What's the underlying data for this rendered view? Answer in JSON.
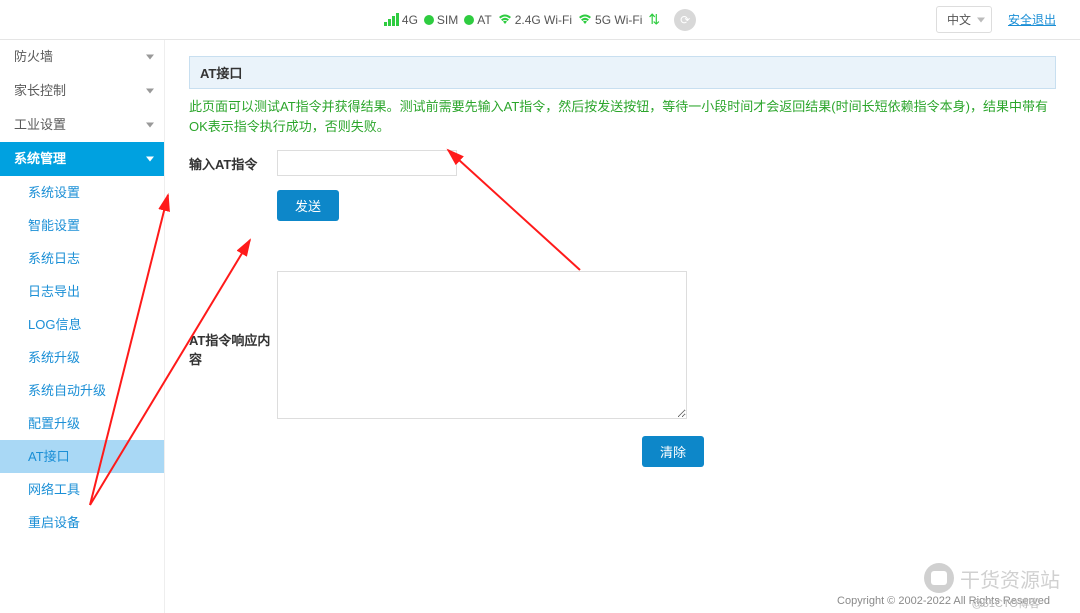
{
  "topbar": {
    "status": {
      "s4g": "4G",
      "sim": "SIM",
      "at": "AT",
      "wifi24": "2.4G Wi-Fi",
      "wifi5": "5G Wi-Fi"
    },
    "lang": "中文",
    "logout": "安全退出"
  },
  "sidebar": {
    "groups": [
      {
        "label": "防火墙"
      },
      {
        "label": "家长控制"
      },
      {
        "label": "工业设置"
      },
      {
        "label": "系统管理",
        "active": true
      }
    ],
    "submenu": [
      {
        "label": "系统设置"
      },
      {
        "label": "智能设置"
      },
      {
        "label": "系统日志"
      },
      {
        "label": "日志导出"
      },
      {
        "label": "LOG信息"
      },
      {
        "label": "系统升级"
      },
      {
        "label": "系统自动升级"
      },
      {
        "label": "配置升级"
      },
      {
        "label": "AT接口",
        "active": true
      },
      {
        "label": "网络工具"
      },
      {
        "label": "重启设备"
      }
    ]
  },
  "content": {
    "panel_title": "AT接口",
    "panel_desc": "此页面可以测试AT指令并获得结果。测试前需要先输入AT指令，然后按发送按钮，等待一小段时间才会返回结果(时间长短依赖指令本身)，结果中带有OK表示指令执行成功，否则失败。",
    "input_label": "输入AT指令",
    "send_btn": "发送",
    "resp_label": "AT指令响应内容",
    "clear_btn": "清除"
  },
  "footer": "Copyright © 2002-2022 All Rights Reserved",
  "watermark": {
    "text": "干货资源站",
    "sub": "@51CTO博客"
  }
}
